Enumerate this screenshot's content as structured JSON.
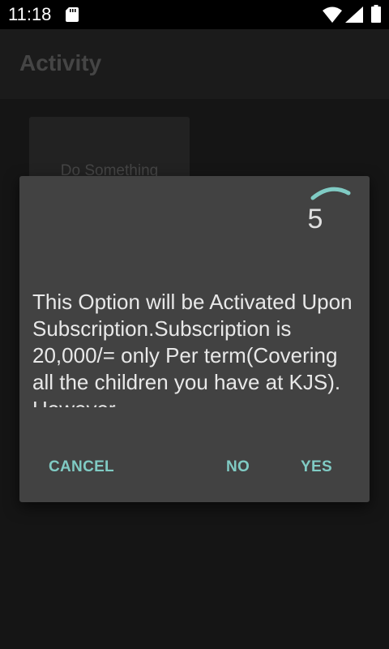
{
  "status_bar": {
    "time": "11:18",
    "icons": [
      "sd-card-icon",
      "wifi-icon",
      "signal-icon",
      "battery-icon"
    ]
  },
  "app_bar": {
    "title": "Activity"
  },
  "background": {
    "button_label": "Do Something"
  },
  "dialog": {
    "countdown": "5",
    "message": "This Option will be Activated Upon Subscription.Subscription is 20,000/= only Per term(Covering all the children you have at KJS). However",
    "buttons": {
      "cancel": "CANCEL",
      "no": "NO",
      "yes": "YES"
    }
  },
  "colors": {
    "accent": "#80cbc4",
    "dialog_bg": "#424242",
    "status_bar": "#000000"
  }
}
